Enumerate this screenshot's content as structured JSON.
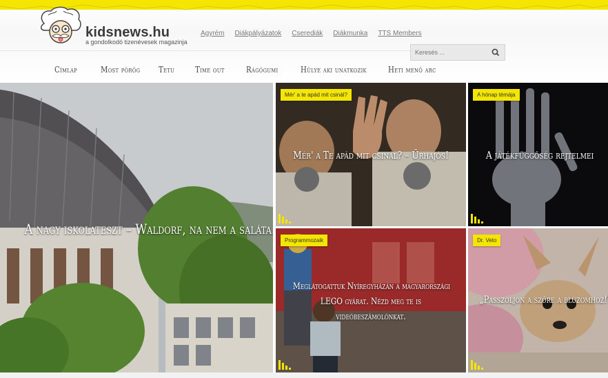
{
  "brand": {
    "name": "kidsnews.hu",
    "tagline": "a gondolkodó tizenévesek magazinja"
  },
  "top_links": [
    {
      "label": "Agyrém"
    },
    {
      "label": "Diákpályázatok"
    },
    {
      "label": "Cserediák"
    },
    {
      "label": "Diákmunka"
    },
    {
      "label": "TTS Members"
    }
  ],
  "search": {
    "placeholder": "Keresés ..."
  },
  "nav": [
    {
      "label": "Címlap"
    },
    {
      "label": "Most pörög"
    },
    {
      "label": "Tetu"
    },
    {
      "label": "Time out"
    },
    {
      "label": "Rágógumi"
    },
    {
      "label": "Hülye aki unatkozik"
    },
    {
      "label": "Heti menő arc"
    }
  ],
  "tiles": {
    "big": {
      "title": "A nagy iskolateszt – Waldorf, na nem a saláta..."
    },
    "t1": {
      "tag": "Mér' a te apád mit csinál?",
      "title": "Mér' a Te apád mit csinál? – Űrhajós!"
    },
    "t2": {
      "tag": "A hónap témája",
      "title": "A játékfüggőség rejtelmei"
    },
    "t3": {
      "tag": "Programmozaik",
      "title_lines": [
        "Meglátogattuk Nyíregyházán a magyarországi",
        "LEGO gyárat. Nézd meg te is",
        "videóbeszámolónkat."
      ]
    },
    "t4": {
      "tag": "Dr. Veto",
      "title": "„Passzoljon a szőre a blúzomhoz!\""
    }
  },
  "colors": {
    "accent_yellow": "#f4e600"
  }
}
